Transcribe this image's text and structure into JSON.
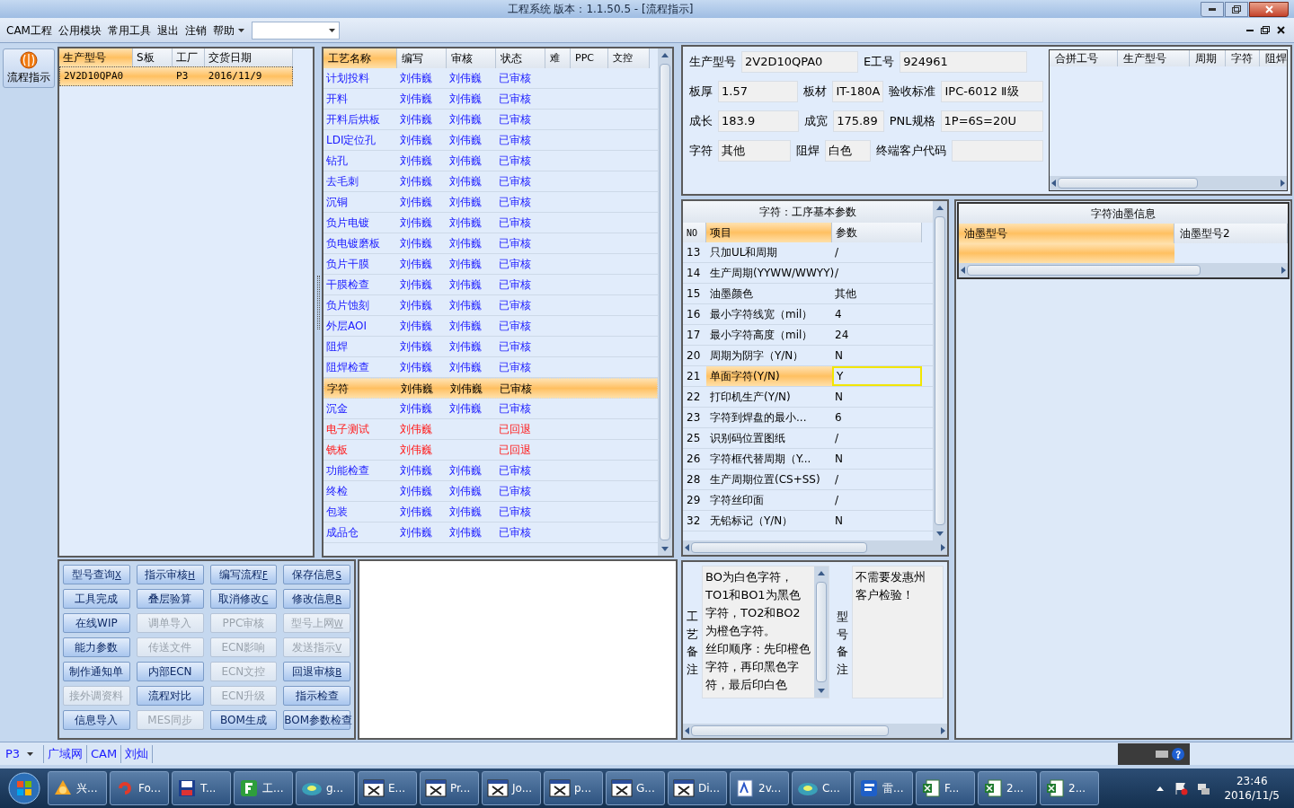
{
  "window": {
    "title": "工程系统   版本：1.1.50.5 - [流程指示]"
  },
  "menu": {
    "items": [
      {
        "label": "CAM工程"
      },
      {
        "label": "公用模块"
      },
      {
        "label": "常用工具"
      },
      {
        "label": "退出"
      },
      {
        "label": "注销"
      },
      {
        "label": "帮助",
        "kind": "dropdown"
      }
    ]
  },
  "side_button": {
    "label": "流程指示"
  },
  "orders": {
    "columns": [
      {
        "label": "生产型号",
        "highlighted": true
      },
      {
        "label": "S板",
        "highlighted": false
      },
      {
        "label": "工厂",
        "highlighted": false
      },
      {
        "label": "交货日期",
        "highlighted": false
      }
    ],
    "rows": [
      {
        "cells": [
          "2V2D10QPA0",
          "",
          "P3",
          "2016/11/9"
        ],
        "selected": true
      }
    ]
  },
  "process": {
    "columns": [
      {
        "label": "工艺名称",
        "highlighted": true
      },
      {
        "label": "编写",
        "highlighted": false
      },
      {
        "label": "审核",
        "highlighted": false
      },
      {
        "label": "状态",
        "highlighted": false
      },
      {
        "label": "难",
        "highlighted": false
      },
      {
        "label": "PPC",
        "highlighted": false
      },
      {
        "label": "文控",
        "highlighted": false
      }
    ],
    "rows": [
      {
        "name": "计划投料",
        "writer": "刘伟巍",
        "reviewer": "刘伟巍",
        "status": "已审核",
        "kind": "approved",
        "selected": false
      },
      {
        "name": "开料",
        "writer": "刘伟巍",
        "reviewer": "刘伟巍",
        "status": "已审核",
        "kind": "approved",
        "selected": false
      },
      {
        "name": "开料后烘板",
        "writer": "刘伟巍",
        "reviewer": "刘伟巍",
        "status": "已审核",
        "kind": "approved",
        "selected": false
      },
      {
        "name": "LDI定位孔",
        "writer": "刘伟巍",
        "reviewer": "刘伟巍",
        "status": "已审核",
        "kind": "approved",
        "selected": false
      },
      {
        "name": "钻孔",
        "writer": "刘伟巍",
        "reviewer": "刘伟巍",
        "status": "已审核",
        "kind": "approved",
        "selected": false
      },
      {
        "name": "去毛刺",
        "writer": "刘伟巍",
        "reviewer": "刘伟巍",
        "status": "已审核",
        "kind": "approved",
        "selected": false
      },
      {
        "name": "沉铜",
        "writer": "刘伟巍",
        "reviewer": "刘伟巍",
        "status": "已审核",
        "kind": "approved",
        "selected": false
      },
      {
        "name": "负片电镀",
        "writer": "刘伟巍",
        "reviewer": "刘伟巍",
        "status": "已审核",
        "kind": "approved",
        "selected": false
      },
      {
        "name": "负电镀磨板",
        "writer": "刘伟巍",
        "reviewer": "刘伟巍",
        "status": "已审核",
        "kind": "approved",
        "selected": false
      },
      {
        "name": "负片干膜",
        "writer": "刘伟巍",
        "reviewer": "刘伟巍",
        "status": "已审核",
        "kind": "approved",
        "selected": false
      },
      {
        "name": "干膜检查",
        "writer": "刘伟巍",
        "reviewer": "刘伟巍",
        "status": "已审核",
        "kind": "approved",
        "selected": false
      },
      {
        "name": "负片蚀刻",
        "writer": "刘伟巍",
        "reviewer": "刘伟巍",
        "status": "已审核",
        "kind": "approved",
        "selected": false
      },
      {
        "name": "外层AOI",
        "writer": "刘伟巍",
        "reviewer": "刘伟巍",
        "status": "已审核",
        "kind": "approved",
        "selected": false
      },
      {
        "name": "阻焊",
        "writer": "刘伟巍",
        "reviewer": "刘伟巍",
        "status": "已审核",
        "kind": "approved",
        "selected": false
      },
      {
        "name": "阻焊检查",
        "writer": "刘伟巍",
        "reviewer": "刘伟巍",
        "status": "已审核",
        "kind": "approved",
        "selected": false
      },
      {
        "name": "字符",
        "writer": "刘伟巍",
        "reviewer": "刘伟巍",
        "status": "已审核",
        "kind": "approved",
        "selected": true
      },
      {
        "name": "沉金",
        "writer": "刘伟巍",
        "reviewer": "刘伟巍",
        "status": "已审核",
        "kind": "approved",
        "selected": false
      },
      {
        "name": "电子测试",
        "writer": "刘伟巍",
        "status": "已回退",
        "kind": "returned",
        "selected": false
      },
      {
        "name": "铣板",
        "writer": "刘伟巍",
        "status": "已回退",
        "kind": "returned",
        "selected": false
      },
      {
        "name": "功能检查",
        "writer": "刘伟巍",
        "reviewer": "刘伟巍",
        "status": "已审核",
        "kind": "approved",
        "selected": false
      },
      {
        "name": "终检",
        "writer": "刘伟巍",
        "reviewer": "刘伟巍",
        "status": "已审核",
        "kind": "approved",
        "selected": false
      },
      {
        "name": "包装",
        "writer": "刘伟巍",
        "reviewer": "刘伟巍",
        "status": "已审核",
        "kind": "approved",
        "selected": false
      },
      {
        "name": "成品仓",
        "writer": "刘伟巍",
        "reviewer": "刘伟巍",
        "status": "已审核",
        "kind": "approved",
        "selected": false
      }
    ]
  },
  "actions": [
    {
      "label": "型号查询",
      "shortcut": "X",
      "disabled": false
    },
    {
      "label": "指示审核",
      "shortcut": "H",
      "disabled": false
    },
    {
      "label": "编写流程",
      "shortcut": "F",
      "disabled": false
    },
    {
      "label": "保存信息",
      "shortcut": "S",
      "disabled": false
    },
    {
      "label": "工具完成",
      "disabled": false
    },
    {
      "label": "叠层验算",
      "disabled": false
    },
    {
      "label": "取消修改",
      "shortcut": "C",
      "disabled": false
    },
    {
      "label": "修改信息",
      "shortcut": "R",
      "disabled": false
    },
    {
      "label": "在线WIP",
      "disabled": false
    },
    {
      "label": "调单导入",
      "disabled": true
    },
    {
      "label": "PPC审核",
      "disabled": true
    },
    {
      "label": "型号上网",
      "shortcut": "W",
      "disabled": true
    },
    {
      "label": "能力参数",
      "disabled": false
    },
    {
      "label": "传送文件",
      "disabled": true
    },
    {
      "label": "ECN影响",
      "disabled": true
    },
    {
      "label": "发送指示",
      "shortcut": "V",
      "disabled": true
    },
    {
      "label": "制作通知单",
      "disabled": false
    },
    {
      "label": "内部ECN",
      "disabled": false
    },
    {
      "label": "ECN文控",
      "disabled": true
    },
    {
      "label": "回退审核",
      "shortcut": "B",
      "disabled": false
    },
    {
      "label": "接外调资料",
      "disabled": true
    },
    {
      "label": "流程对比",
      "disabled": false
    },
    {
      "label": "ECN升级",
      "disabled": true
    },
    {
      "label": "指示检查",
      "disabled": false
    },
    {
      "label": "信息导入",
      "disabled": false
    },
    {
      "label": "MES同步",
      "disabled": true
    },
    {
      "label": "BOM生成",
      "disabled": false
    },
    {
      "label": "BOM参数检查",
      "disabled": false
    }
  ],
  "info": {
    "rows": [
      [
        {
          "label": "生产型号",
          "value": "2V2D10QPA0"
        },
        {
          "label": "E工号",
          "value": "924961"
        }
      ],
      [
        {
          "label": "板厚",
          "value": "1.57"
        },
        {
          "label": "板材",
          "value": "IT-180A"
        },
        {
          "label": "验收标准",
          "value": "IPC-6012 Ⅱ级"
        }
      ],
      [
        {
          "label": "成长",
          "value": "183.9"
        },
        {
          "label": "成宽",
          "value": "175.89"
        },
        {
          "label": "PNL规格",
          "value": "1P=6S=20U"
        }
      ],
      [
        {
          "label": "字符",
          "value": "其他"
        },
        {
          "label": "阻焊",
          "value": "白色"
        },
        {
          "label": "终端客户代码"
        }
      ]
    ]
  },
  "merge_table": {
    "columns": [
      "合拼工号",
      "生产型号",
      "周期",
      "字符",
      "阻焊"
    ]
  },
  "params": {
    "title": "字符：工序基本参数",
    "columns": [
      {
        "label": "NO",
        "highlighted": false
      },
      {
        "label": "项目",
        "highlighted": true
      },
      {
        "label": "参数",
        "highlighted": false
      }
    ],
    "rows": [
      {
        "no": "13",
        "item": "只加UL和周期",
        "value": "/",
        "selected": false
      },
      {
        "no": "14",
        "item": "生产周期(YYWW/WWYY)",
        "value": "/",
        "selected": false
      },
      {
        "no": "15",
        "item": "油墨颜色",
        "value": "其他",
        "selected": false
      },
      {
        "no": "16",
        "item": "最小字符线宽（mil）",
        "value": "4",
        "selected": false
      },
      {
        "no": "17",
        "item": "最小字符高度（mil）",
        "value": "24",
        "selected": false
      },
      {
        "no": "20",
        "item": "周期为阴字（Y/N）",
        "value": "N",
        "selected": false
      },
      {
        "no": "21",
        "item": "单面字符(Y/N)",
        "value": "Y",
        "selected": true
      },
      {
        "no": "22",
        "item": "打印机生产(Y/N)",
        "value": "N",
        "selected": false
      },
      {
        "no": "23",
        "item": "字符到焊盘的最小...",
        "value": "6",
        "selected": false
      },
      {
        "no": "25",
        "item": "识别码位置图纸",
        "value": "/",
        "selected": false
      },
      {
        "no": "26",
        "item": "字符框代替周期（Y...",
        "value": "N",
        "selected": false
      },
      {
        "no": "28",
        "item": "生产周期位置(CS+SS)",
        "value": "/",
        "selected": false
      },
      {
        "no": "29",
        "item": "字符丝印面",
        "value": "/",
        "selected": false
      },
      {
        "no": "32",
        "item": "无铅标记（Y/N）",
        "value": "N",
        "selected": false
      }
    ]
  },
  "ink": {
    "title": "字符油墨信息",
    "columns": [
      {
        "label": "油墨型号",
        "highlighted": true
      },
      {
        "label": "油墨型号2",
        "highlighted": false
      }
    ],
    "rows": [
      {
        "selected": true
      }
    ]
  },
  "notes": {
    "process_label": "工艺备注",
    "process_text": [
      "BO为白色字符，TO1和BO1为黑色字符，TO2和BO2为橙色字符。",
      "丝印顺序：先印橙色字符，再印黑色字符，最后印白色"
    ],
    "model_label": "型号备注",
    "model_text": [
      "不需要发惠州",
      "客户检验！"
    ]
  },
  "status_bar": {
    "factory": "P3",
    "items": [
      "广域网",
      "CAM",
      "刘灿"
    ]
  },
  "taskbar": {
    "items": [
      {
        "label": "兴..."
      },
      {
        "label": "Fo..."
      },
      {
        "label": "T..."
      },
      {
        "label": "工..."
      },
      {
        "label": "g..."
      },
      {
        "label": "E..."
      },
      {
        "label": "Pr..."
      },
      {
        "label": "Jo..."
      },
      {
        "label": "p..."
      },
      {
        "label": "G..."
      },
      {
        "label": "Di..."
      },
      {
        "label": "2v..."
      },
      {
        "label": "C..."
      },
      {
        "label": "雷..."
      },
      {
        "label": "F..."
      },
      {
        "label": "2..."
      },
      {
        "label": "2..."
      }
    ],
    "time": "23:46",
    "date": "2016/11/5"
  }
}
